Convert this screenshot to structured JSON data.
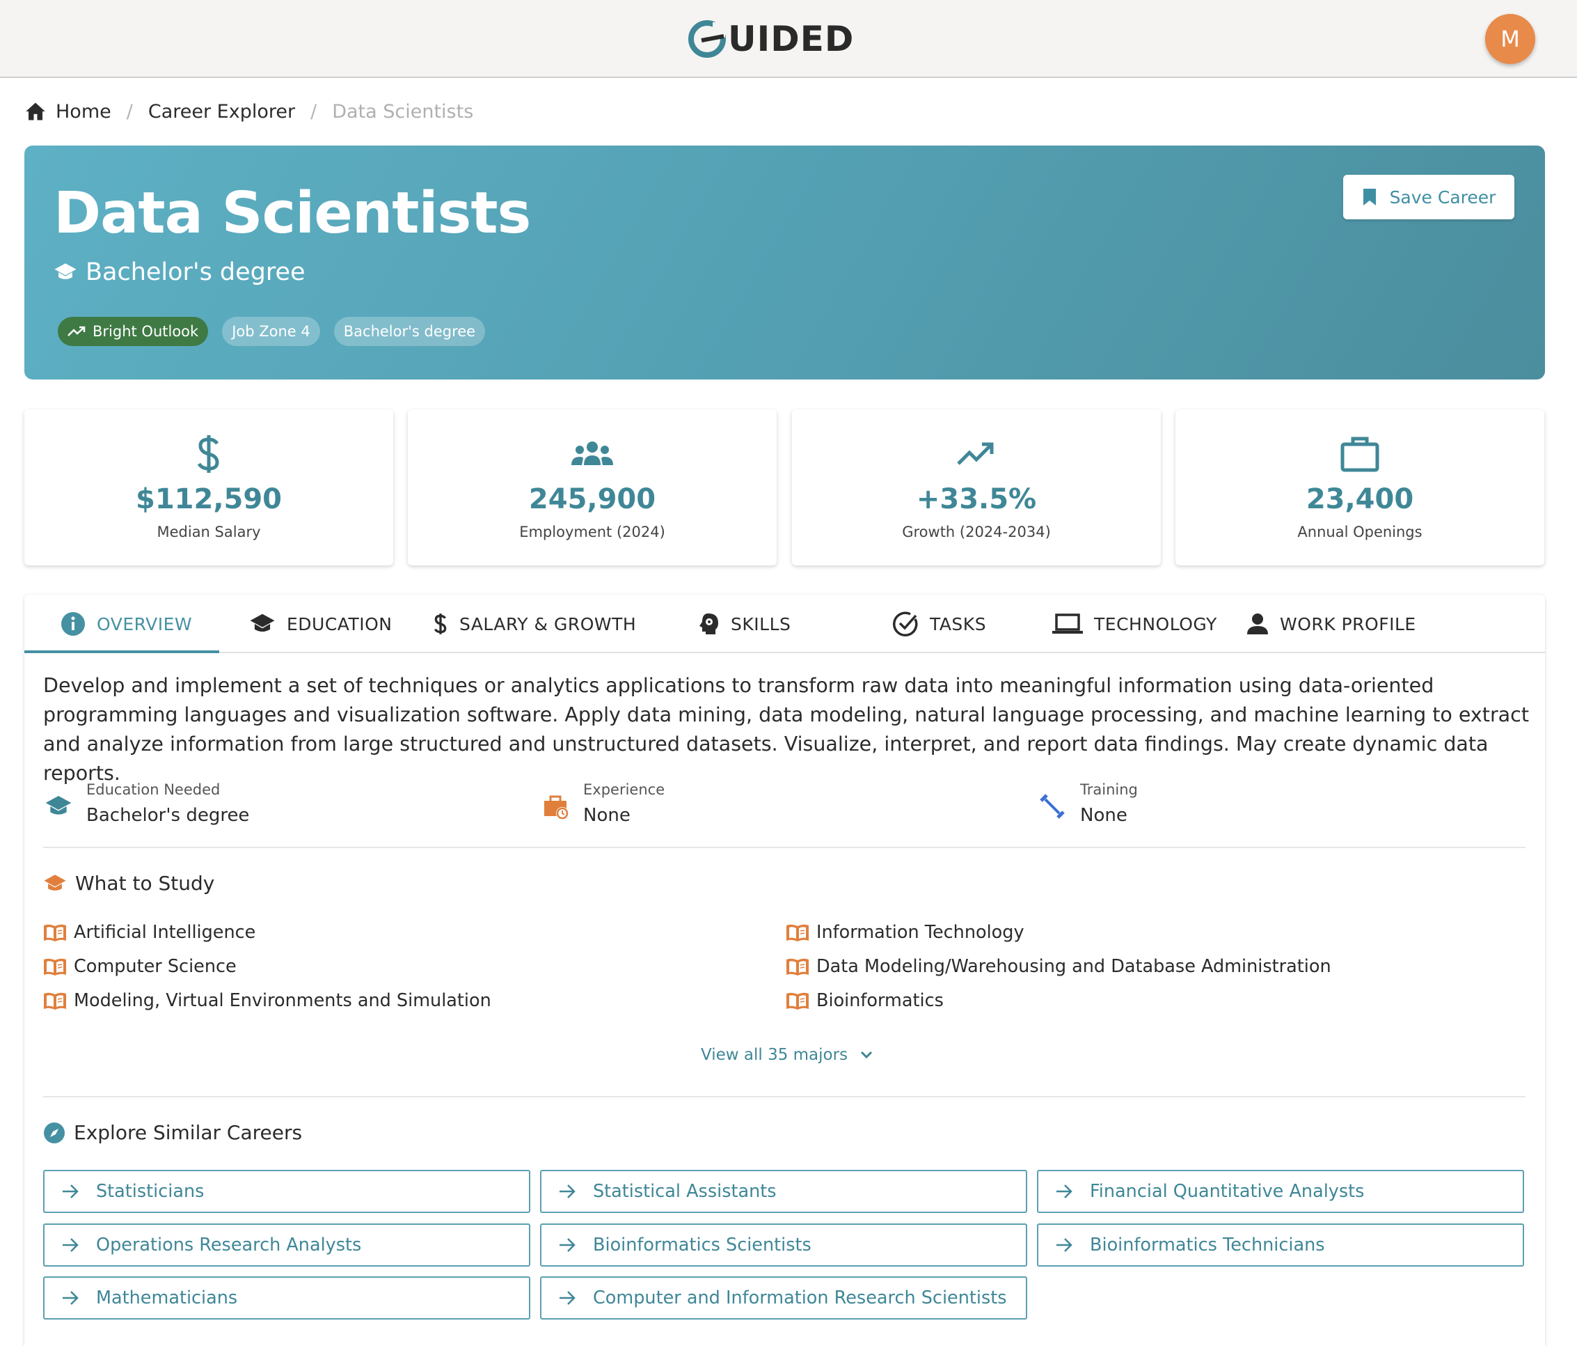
{
  "header": {
    "logo_text": "UIDED",
    "avatar_initial": "M"
  },
  "breadcrumb": {
    "home": "Home",
    "explorer": "Career Explorer",
    "current": "Data Scientists",
    "separator": "/"
  },
  "hero": {
    "title": "Data Scientists",
    "subtitle": "Bachelor's degree",
    "chips": [
      "Bright Outlook",
      "Job Zone 4",
      "Bachelor's degree"
    ],
    "save_label": "Save Career"
  },
  "stats": [
    {
      "icon": "dollar-icon",
      "value": "$112,590",
      "label": "Median Salary"
    },
    {
      "icon": "group-icon",
      "value": "245,900",
      "label": "Employment (2024)"
    },
    {
      "icon": "trending-up-icon",
      "value": "+33.5%",
      "label": "Growth (2024-2034)"
    },
    {
      "icon": "briefcase-icon",
      "value": "23,400",
      "label": "Annual Openings"
    }
  ],
  "tabs": [
    "OVERVIEW",
    "EDUCATION",
    "SALARY & GROWTH",
    "SKILLS",
    "TASKS",
    "TECHNOLOGY",
    "WORK PROFILE"
  ],
  "overview": {
    "description": "Develop and implement a set of techniques or analytics applications to transform raw data into meaningful information using data-oriented programming languages and visualization software. Apply data mining, data modeling, natural language processing, and machine learning to extract and analyze information from large structured and unstructured datasets. Visualize, interpret, and report data findings. May create dynamic data reports.",
    "meta": [
      {
        "label": "Education Needed",
        "value": "Bachelor's degree"
      },
      {
        "label": "Experience",
        "value": "None"
      },
      {
        "label": "Training",
        "value": "None"
      }
    ],
    "study_title": "What to Study",
    "majors": [
      "Artificial Intelligence",
      "Information Technology",
      "Computer Science",
      "Data Modeling/Warehousing and Database Administration",
      "Modeling, Virtual Environments and Simulation",
      "Bioinformatics"
    ],
    "view_all": "View all 35 majors",
    "similar_title": "Explore Similar Careers",
    "similar_careers": [
      "Statisticians",
      "Statistical Assistants",
      "Financial Quantitative Analysts",
      "Operations Research Analysts",
      "Bioinformatics Scientists",
      "Bioinformatics Technicians",
      "Mathematicians",
      "Computer and Information Research Scientists"
    ]
  },
  "colors": {
    "accent": "#4690a3",
    "hero_start": "#5eb0c4",
    "hero_end": "#4b8e9e",
    "bright_outlook": "#3f7a44",
    "avatar": "#e88a4a",
    "study_icon": "#e07f3c"
  }
}
